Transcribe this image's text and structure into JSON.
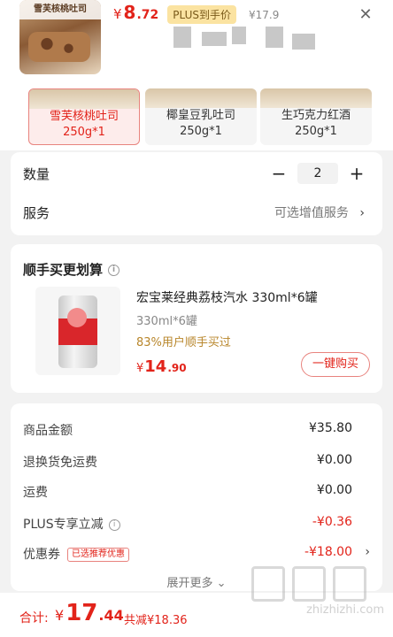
{
  "header": {
    "thumb_caption": "雪芙核桃吐司",
    "price_symbol": "¥",
    "price_int": "8",
    "price_dec": ".72",
    "plus_badge": "PLUS到手价",
    "original_price": "¥17.9",
    "close_icon": "close-icon"
  },
  "variants": [
    {
      "name": "雪芙核桃吐司",
      "spec": "250g*1",
      "selected": true
    },
    {
      "name": "椰皇豆乳吐司",
      "spec": "250g*1",
      "selected": false
    },
    {
      "name": "生巧克力红酒",
      "spec": "250g*1",
      "selected": false
    }
  ],
  "quantity": {
    "label": "数量",
    "minus": "−",
    "value": "2",
    "plus": "+"
  },
  "service": {
    "label": "服务",
    "value": "可选增值服务",
    "chevron": "›"
  },
  "bundle": {
    "title": "顺手买更划算",
    "info_icon": "i",
    "product_name": "宏宝莱经典荔枝汽水 330ml*6罐",
    "spec": "330ml*6罐",
    "stat": "83%用户顺手买过",
    "price_symbol": "¥",
    "price_int": "14",
    "price_dec": ".90",
    "buy_label": "一键购买"
  },
  "summary": {
    "rows": [
      {
        "label": "商品金额",
        "value": "¥35.80"
      },
      {
        "label": "退换货免运费",
        "value": "¥0.00"
      },
      {
        "label": "运费",
        "value": "¥0.00"
      },
      {
        "label": "PLUS专享立减",
        "value": "-¥0.36"
      },
      {
        "label": "优惠券",
        "value": "-¥18.00"
      }
    ],
    "coupon_tag": "已选推荐优惠",
    "expand_label": "展开更多"
  },
  "bottom": {
    "total_label": "合计:",
    "total_symbol": "¥",
    "total_int": "17",
    "total_dec": ".44",
    "saving": "共减¥18.36"
  },
  "watermark": {
    "text": "zhizhizhi.com"
  }
}
